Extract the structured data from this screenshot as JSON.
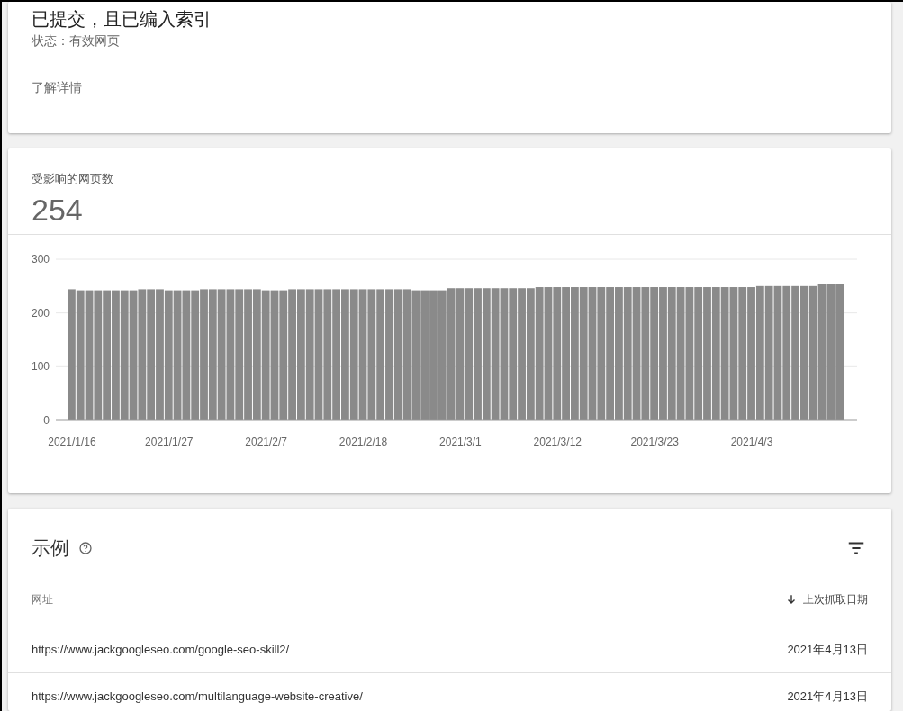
{
  "status_card": {
    "title": "已提交，且已编入索引",
    "status": "状态：有效网页",
    "link": "了解详情"
  },
  "affected_card": {
    "label": "受影响的网页数",
    "count": "254",
    "chart_data": {
      "type": "bar",
      "categories": [
        "2021/1/16",
        null,
        null,
        null,
        null,
        null,
        null,
        null,
        null,
        null,
        null,
        "2021/1/27",
        null,
        null,
        null,
        null,
        null,
        null,
        null,
        null,
        null,
        null,
        "2021/2/7",
        null,
        null,
        null,
        null,
        null,
        null,
        null,
        null,
        null,
        null,
        "2021/2/18",
        null,
        null,
        null,
        null,
        null,
        null,
        null,
        null,
        null,
        null,
        "2021/3/1",
        null,
        null,
        null,
        null,
        null,
        null,
        null,
        null,
        null,
        null,
        "2021/3/12",
        null,
        null,
        null,
        null,
        null,
        null,
        null,
        null,
        null,
        null,
        "2021/3/23",
        null,
        null,
        null,
        null,
        null,
        null,
        null,
        null,
        null,
        null,
        "2021/4/3",
        null,
        null,
        null,
        null,
        null,
        null,
        null,
        null,
        null,
        null
      ],
      "values": [
        244,
        242,
        242,
        242,
        242,
        242,
        242,
        242,
        244,
        244,
        244,
        242,
        242,
        242,
        242,
        244,
        244,
        244,
        244,
        244,
        244,
        244,
        242,
        242,
        242,
        244,
        244,
        244,
        244,
        244,
        244,
        244,
        244,
        244,
        244,
        244,
        244,
        244,
        244,
        242,
        242,
        242,
        242,
        246,
        246,
        246,
        246,
        246,
        246,
        246,
        246,
        246,
        246,
        248,
        248,
        248,
        248,
        248,
        248,
        248,
        248,
        248,
        248,
        248,
        248,
        248,
        248,
        248,
        248,
        248,
        248,
        248,
        248,
        248,
        248,
        248,
        248,
        248,
        250,
        250,
        250,
        250,
        250,
        250,
        250,
        254,
        254,
        254
      ],
      "ylim": [
        0,
        300
      ],
      "yticks": [
        0,
        100,
        200,
        300
      ]
    }
  },
  "examples": {
    "title": "示例",
    "columns": [
      {
        "label": "网址",
        "sorted": false
      },
      {
        "label": "上次抓取日期",
        "sorted": true
      }
    ],
    "rows": [
      {
        "url": "https://www.jackgoogleseo.com/google-seo-skill2/",
        "date": "2021年4月13日"
      },
      {
        "url": "https://www.jackgoogleseo.com/multilanguage-website-creative/",
        "date": "2021年4月13日"
      }
    ]
  }
}
